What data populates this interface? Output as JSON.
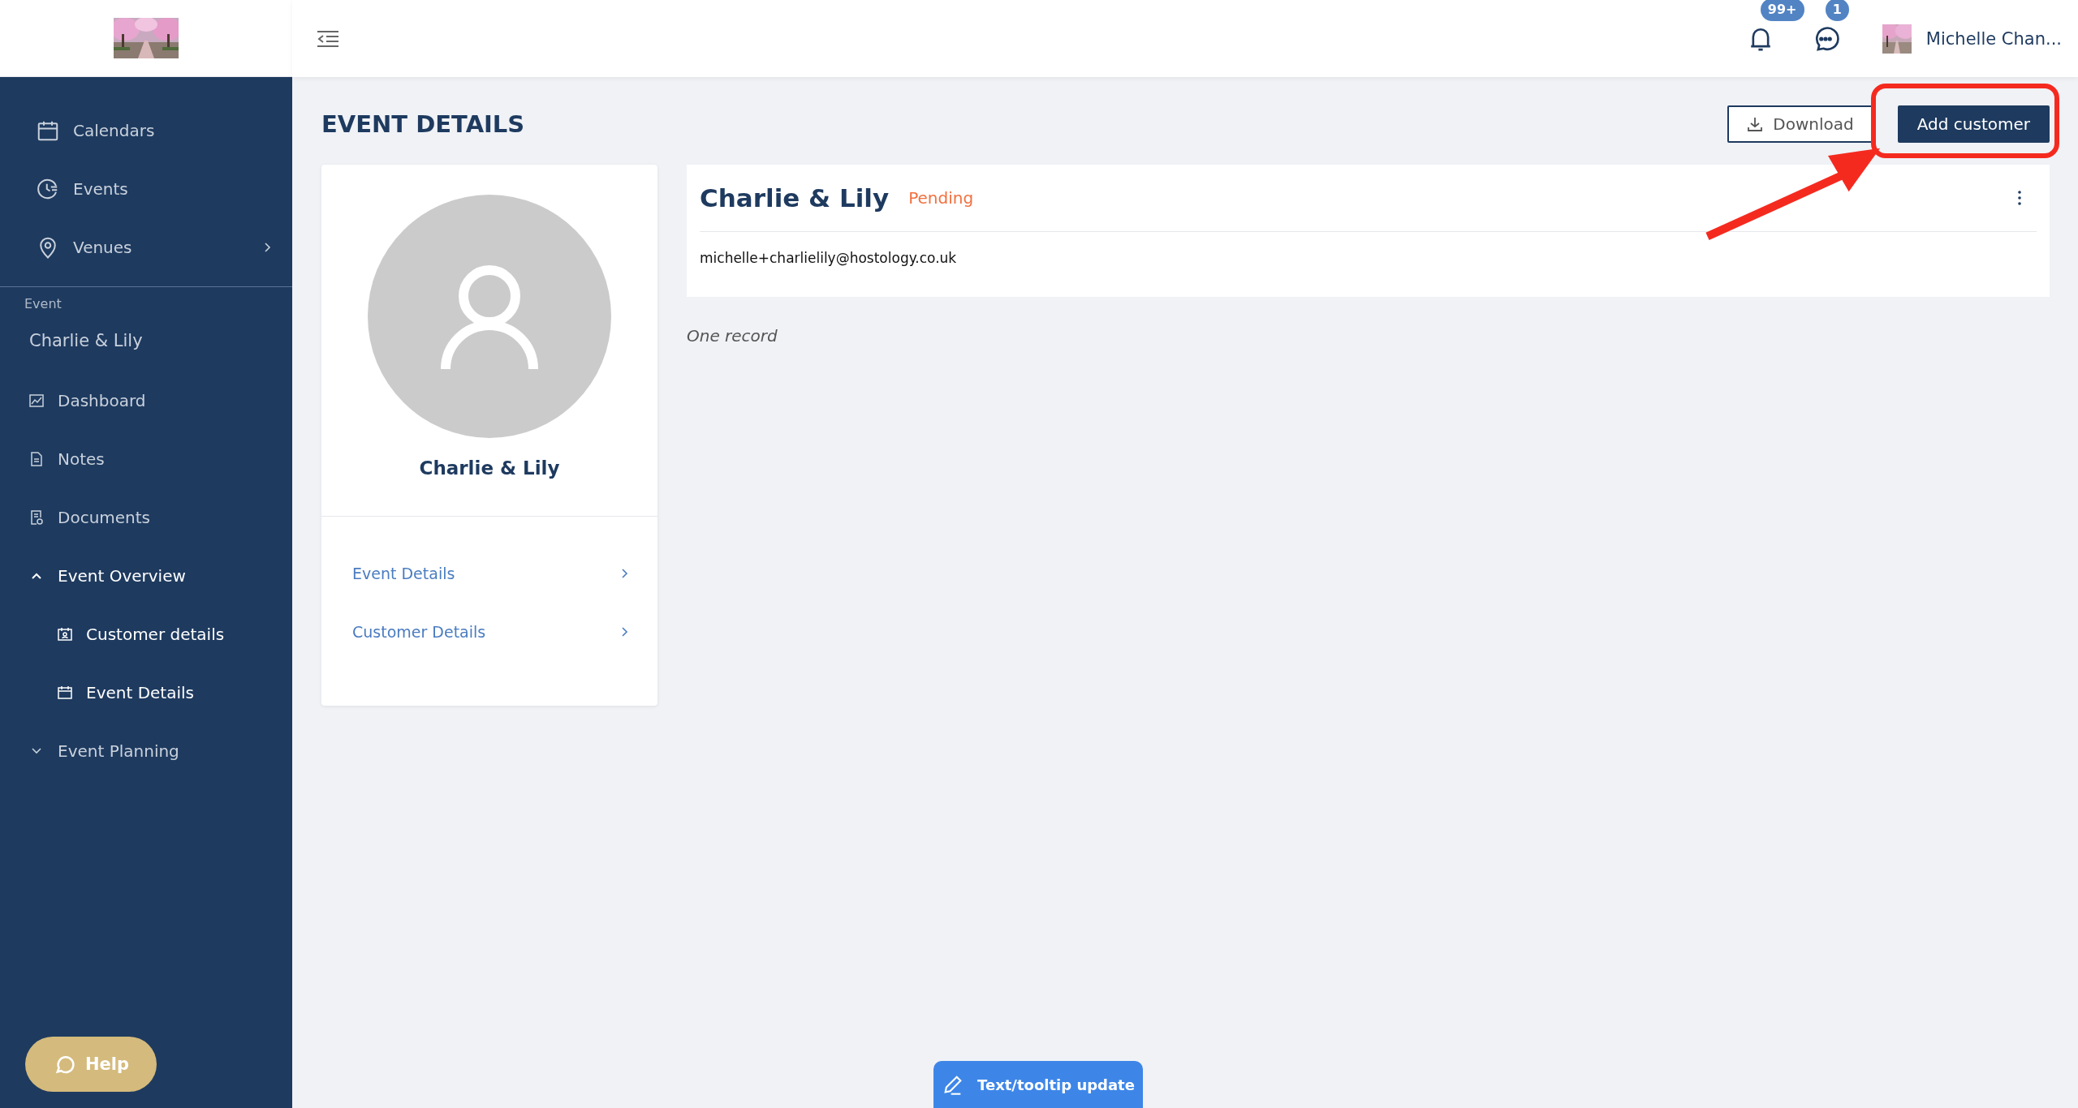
{
  "sidebar": {
    "main_items": [
      {
        "label": "Calendars",
        "has_submenu": false
      },
      {
        "label": "Events",
        "has_submenu": false
      },
      {
        "label": "Venues",
        "has_submenu": true
      }
    ],
    "section_label": "Event",
    "event_name": "Charlie & Lily",
    "event_items": [
      {
        "label": "Dashboard"
      },
      {
        "label": "Notes"
      },
      {
        "label": "Documents"
      },
      {
        "label": "Event Overview",
        "expanded": true,
        "children": [
          {
            "label": "Customer details"
          },
          {
            "label": "Event Details"
          }
        ]
      },
      {
        "label": "Event Planning",
        "expanded": false
      }
    ],
    "help_button": "Help"
  },
  "topbar": {
    "notifications_badge": "99+",
    "messages_badge": "1",
    "user_name": "Michelle Chan..."
  },
  "page_title": "EVENT DETAILS",
  "actions": [
    {
      "label": "Download",
      "kind": "outline"
    },
    {
      "label": "Add customer",
      "kind": "primary"
    }
  ],
  "profile_card": {
    "name": "Charlie & Lily",
    "links": [
      "Event Details",
      "Customer Details"
    ]
  },
  "records": [
    {
      "name": "Charlie & Lily",
      "status": "Pending",
      "email": "michelle+charlielily@hostology.co.uk"
    }
  ],
  "record_count": "One record",
  "feedback_button": "Text/tooltip update"
}
